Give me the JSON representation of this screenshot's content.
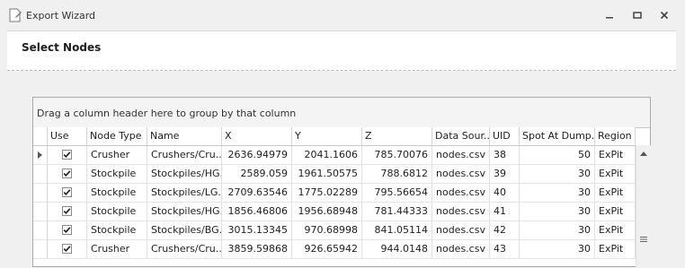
{
  "window": {
    "title": "Export Wizard",
    "app_icon": "document-edit-icon",
    "buttons": [
      "minimize-icon",
      "restore-icon",
      "close-icon"
    ]
  },
  "page": {
    "title": "Select Nodes"
  },
  "grid": {
    "group_panel_text": "Drag a column header here to group by that column",
    "columns": [
      "Use",
      "Node Type",
      "Name",
      "X",
      "Y",
      "Z",
      "Data Sour...",
      "UID",
      "Spot At Dump...",
      "Region"
    ],
    "rows": [
      {
        "use": true,
        "node_type": "Crusher",
        "name": "Crushers/Cru...",
        "x": "2636.94979",
        "y": "2041.1606",
        "z": "785.70076",
        "data_source": "nodes.csv",
        "uid": "38",
        "spot_at_dump": "50",
        "region": "ExPit"
      },
      {
        "use": true,
        "node_type": "Stockpile",
        "name": "Stockpiles/HG...",
        "x": "2589.059",
        "y": "1961.50575",
        "z": "788.6812",
        "data_source": "nodes.csv",
        "uid": "39",
        "spot_at_dump": "30",
        "region": "ExPit"
      },
      {
        "use": true,
        "node_type": "Stockpile",
        "name": "Stockpiles/LG...",
        "x": "2709.63546",
        "y": "1775.02289",
        "z": "795.56654",
        "data_source": "nodes.csv",
        "uid": "40",
        "spot_at_dump": "30",
        "region": "ExPit"
      },
      {
        "use": true,
        "node_type": "Stockpile",
        "name": "Stockpiles/HG...",
        "x": "1856.46806",
        "y": "1956.68948",
        "z": "781.44333",
        "data_source": "nodes.csv",
        "uid": "41",
        "spot_at_dump": "30",
        "region": "ExPit"
      },
      {
        "use": true,
        "node_type": "Stockpile",
        "name": "Stockpiles/BG...",
        "x": "3015.13345",
        "y": "970.68998",
        "z": "841.05114",
        "data_source": "nodes.csv",
        "uid": "42",
        "spot_at_dump": "30",
        "region": "ExPit"
      },
      {
        "use": true,
        "node_type": "Crusher",
        "name": "Crushers/Cru...",
        "x": "3859.59868",
        "y": "926.65942",
        "z": "944.0148",
        "data_source": "nodes.csv",
        "uid": "43",
        "spot_at_dump": "30",
        "region": "ExPit"
      }
    ]
  },
  "colors": {
    "checkmark": "#1e1e1e",
    "grid_border": "#a9a9a9",
    "header_bg": "#ffffff"
  }
}
